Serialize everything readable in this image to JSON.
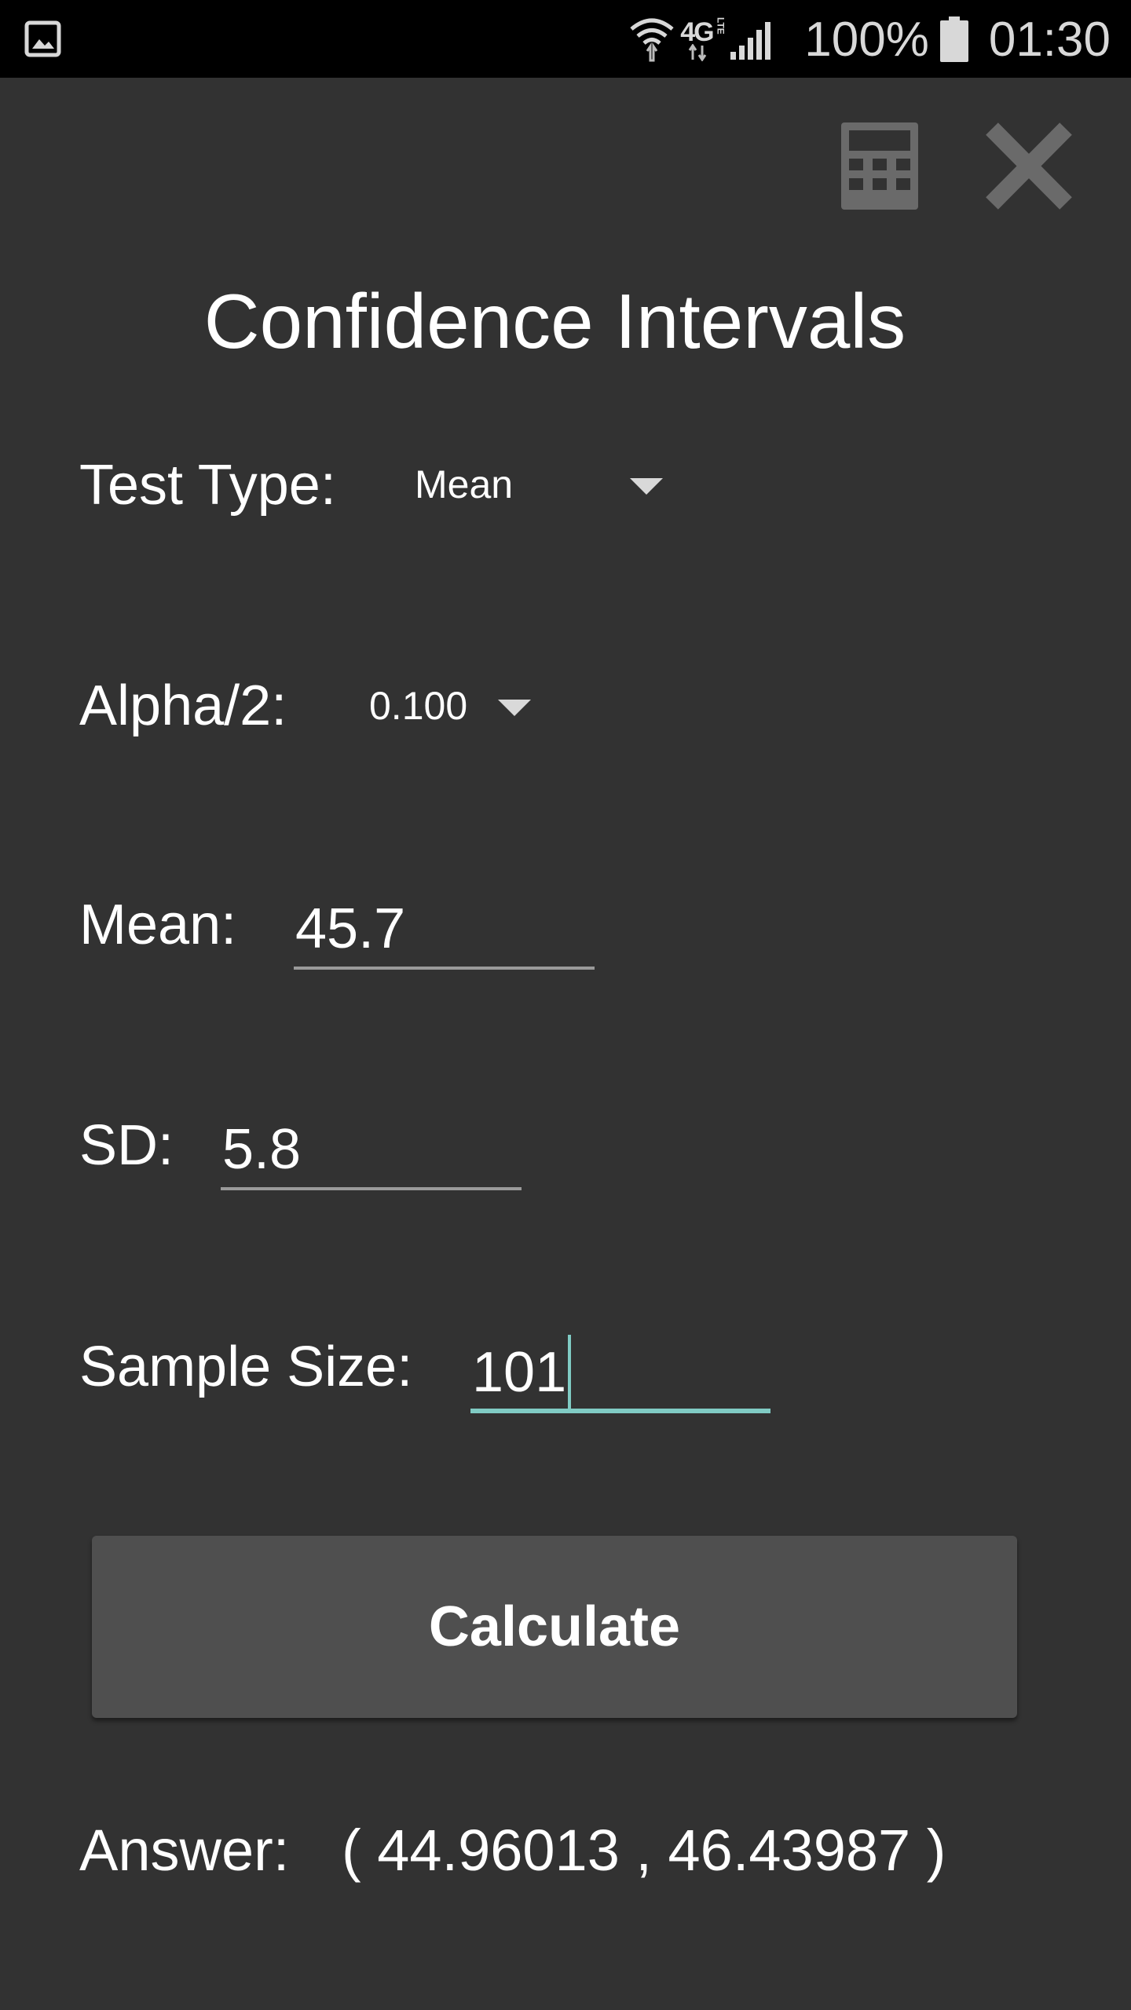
{
  "status_bar": {
    "gallery_icon": "image-icon",
    "wifi_icon": "wifi-icon",
    "network_label": "4G",
    "network_sub": "LTE",
    "signal_icon": "signal-icon",
    "battery_text": "100%",
    "battery_icon": "battery-icon",
    "time": "01:30"
  },
  "toolbar": {
    "calculator_icon": "calculator-icon",
    "close_icon": "close-icon"
  },
  "page": {
    "title": "Confidence Intervals"
  },
  "form": {
    "test_type_label": "Test Type:",
    "test_type_value": "Mean",
    "alpha_label": "Alpha/2:",
    "alpha_value": "0.100",
    "mean_label": "Mean:",
    "mean_value": "45.7",
    "sd_label": "SD:",
    "sd_value": "5.8",
    "sample_size_label": "Sample Size:",
    "sample_size_value": "101"
  },
  "actions": {
    "calculate_label": "Calculate"
  },
  "result": {
    "answer_label": "Answer:",
    "answer_value": "( 44.96013 ,  46.43987 )"
  },
  "colors": {
    "background": "#323232",
    "status_bar": "#000000",
    "button": "#4f4f4f",
    "accent": "#80cbc4",
    "underline": "#9a9a9a",
    "icon_gray": "#6a6a6a"
  }
}
